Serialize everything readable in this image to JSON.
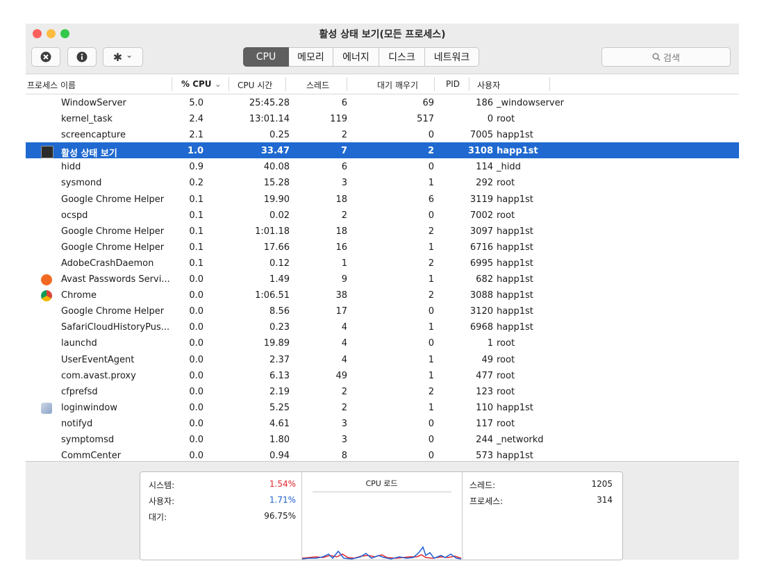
{
  "window": {
    "title": "활성 상태 보기(모든 프로세스)",
    "traffic_colors": [
      "#fc605c",
      "#fdbc40",
      "#34c84a"
    ]
  },
  "toolbar": {
    "stop_icon": "x-circle-icon",
    "info_icon": "info-icon",
    "gear_icon": "gear-icon",
    "gear_chevron": "⌄",
    "tabs": [
      {
        "label": "CPU",
        "active": true
      },
      {
        "label": "메모리",
        "active": false
      },
      {
        "label": "에너지",
        "active": false
      },
      {
        "label": "디스크",
        "active": false
      },
      {
        "label": "네트워크",
        "active": false
      }
    ],
    "search_placeholder": "검색"
  },
  "columns": {
    "name": "프로세스 이름",
    "cpu": "% CPU",
    "cpu_sort": "⌄",
    "time": "CPU 시간",
    "threads": "스레드",
    "wakeups": "대기 깨우기",
    "pid": "PID",
    "user": "사용자"
  },
  "processes": [
    {
      "name": "WindowServer",
      "cpu": "5.0",
      "time": "25:45.28",
      "threads": "6",
      "wakeups": "69",
      "pid": "186",
      "user": "_windowserver"
    },
    {
      "name": "kernel_task",
      "cpu": "2.4",
      "time": "13:01.14",
      "threads": "119",
      "wakeups": "517",
      "pid": "0",
      "user": "root"
    },
    {
      "name": "screencapture",
      "cpu": "2.1",
      "time": "0.25",
      "threads": "2",
      "wakeups": "0",
      "pid": "7005",
      "user": "happ1st"
    },
    {
      "name": "활성 상태 보기",
      "cpu": "1.0",
      "time": "33.47",
      "threads": "7",
      "wakeups": "2",
      "pid": "3108",
      "user": "happ1st",
      "selected": true,
      "icon": "activity-monitor-icon"
    },
    {
      "name": "hidd",
      "cpu": "0.9",
      "time": "40.08",
      "threads": "6",
      "wakeups": "0",
      "pid": "114",
      "user": "_hidd"
    },
    {
      "name": "sysmond",
      "cpu": "0.2",
      "time": "15.28",
      "threads": "3",
      "wakeups": "1",
      "pid": "292",
      "user": "root"
    },
    {
      "name": "Google Chrome Helper",
      "cpu": "0.1",
      "time": "19.90",
      "threads": "18",
      "wakeups": "6",
      "pid": "3119",
      "user": "happ1st"
    },
    {
      "name": "ocspd",
      "cpu": "0.1",
      "time": "0.02",
      "threads": "2",
      "wakeups": "0",
      "pid": "7002",
      "user": "root"
    },
    {
      "name": "Google Chrome Helper",
      "cpu": "0.1",
      "time": "1:01.18",
      "threads": "18",
      "wakeups": "2",
      "pid": "3097",
      "user": "happ1st"
    },
    {
      "name": "Google Chrome Helper",
      "cpu": "0.1",
      "time": "17.66",
      "threads": "16",
      "wakeups": "1",
      "pid": "6716",
      "user": "happ1st"
    },
    {
      "name": "AdobeCrashDaemon",
      "cpu": "0.1",
      "time": "0.12",
      "threads": "1",
      "wakeups": "2",
      "pid": "6995",
      "user": "happ1st"
    },
    {
      "name": "Avast Passwords Servi...",
      "cpu": "0.0",
      "time": "1.49",
      "threads": "9",
      "wakeups": "1",
      "pid": "682",
      "user": "happ1st",
      "icon": "avast-icon"
    },
    {
      "name": "Chrome",
      "cpu": "0.0",
      "time": "1:06.51",
      "threads": "38",
      "wakeups": "2",
      "pid": "3088",
      "user": "happ1st",
      "icon": "chrome-icon"
    },
    {
      "name": "Google Chrome Helper",
      "cpu": "0.0",
      "time": "8.56",
      "threads": "17",
      "wakeups": "0",
      "pid": "3120",
      "user": "happ1st"
    },
    {
      "name": "SafariCloudHistoryPus...",
      "cpu": "0.0",
      "time": "0.23",
      "threads": "4",
      "wakeups": "1",
      "pid": "6968",
      "user": "happ1st"
    },
    {
      "name": "launchd",
      "cpu": "0.0",
      "time": "19.89",
      "threads": "4",
      "wakeups": "0",
      "pid": "1",
      "user": "root"
    },
    {
      "name": "UserEventAgent",
      "cpu": "0.0",
      "time": "2.37",
      "threads": "4",
      "wakeups": "1",
      "pid": "49",
      "user": "root"
    },
    {
      "name": "com.avast.proxy",
      "cpu": "0.0",
      "time": "6.13",
      "threads": "49",
      "wakeups": "1",
      "pid": "477",
      "user": "root"
    },
    {
      "name": "cfprefsd",
      "cpu": "0.0",
      "time": "2.19",
      "threads": "2",
      "wakeups": "2",
      "pid": "123",
      "user": "root"
    },
    {
      "name": "loginwindow",
      "cpu": "0.0",
      "time": "5.25",
      "threads": "2",
      "wakeups": "1",
      "pid": "110",
      "user": "happ1st",
      "icon": "loginwindow-icon"
    },
    {
      "name": "notifyd",
      "cpu": "0.0",
      "time": "4.61",
      "threads": "3",
      "wakeups": "0",
      "pid": "117",
      "user": "root"
    },
    {
      "name": "symptomsd",
      "cpu": "0.0",
      "time": "1.80",
      "threads": "3",
      "wakeups": "0",
      "pid": "244",
      "user": "_networkd"
    },
    {
      "name": "CommCenter",
      "cpu": "0.0",
      "time": "0.94",
      "threads": "8",
      "wakeups": "0",
      "pid": "573",
      "user": "happ1st"
    }
  ],
  "summary": {
    "system_label": "시스템:",
    "system_value": "1.54%",
    "system_color": "#e0242a",
    "user_label": "사용자:",
    "user_value": "1.71%",
    "user_color": "#1f5fd1",
    "idle_label": "대기:",
    "idle_value": "96.75%",
    "cpu_load_title": "CPU 로드",
    "threads_label": "스레드:",
    "threads_value": "1205",
    "processes_label": "프로세스:",
    "processes_value": "314"
  }
}
